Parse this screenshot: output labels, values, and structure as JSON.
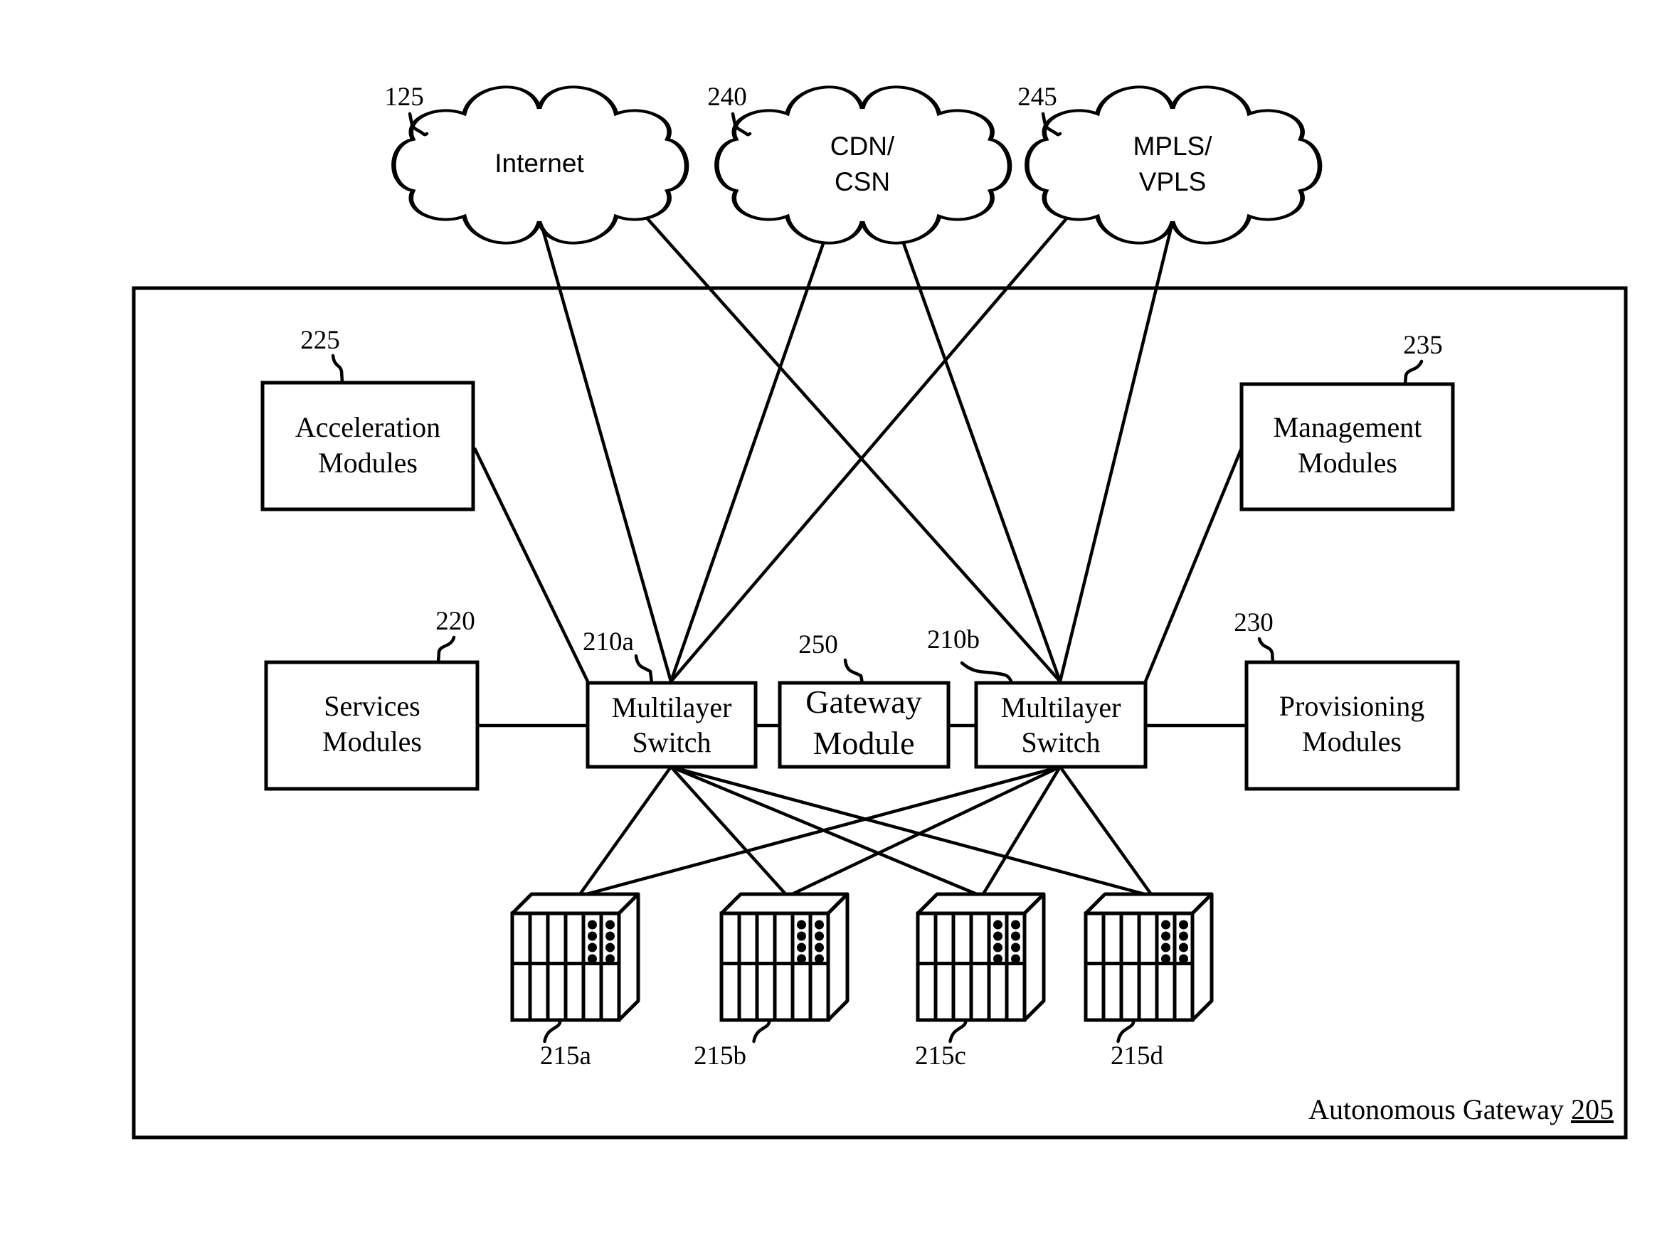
{
  "figure": {
    "container": {
      "label": "Autonomous Gateway",
      "ref": "205"
    },
    "clouds": [
      {
        "id": "internet",
        "ref": "125",
        "lines": [
          "Internet"
        ]
      },
      {
        "id": "cdn",
        "ref": "240",
        "lines": [
          "CDN/",
          "CSN"
        ]
      },
      {
        "id": "mpls",
        "ref": "245",
        "lines": [
          "MPLS/",
          "VPLS"
        ]
      }
    ],
    "modules": [
      {
        "id": "acceleration",
        "ref": "225",
        "lines": [
          "Acceleration",
          "Modules"
        ]
      },
      {
        "id": "management",
        "ref": "235",
        "lines": [
          "Management",
          "Modules"
        ]
      },
      {
        "id": "services",
        "ref": "220",
        "lines": [
          "Services",
          "Modules"
        ]
      },
      {
        "id": "provisioning",
        "ref": "230",
        "lines": [
          "Provisioning",
          "Modules"
        ]
      },
      {
        "id": "switch-a",
        "ref": "210a",
        "lines": [
          "Multilayer",
          "Switch"
        ]
      },
      {
        "id": "gateway",
        "ref": "250",
        "lines": [
          "Gateway",
          "Module"
        ]
      },
      {
        "id": "switch-b",
        "ref": "210b",
        "lines": [
          "Multilayer",
          "Switch"
        ]
      }
    ],
    "servers": [
      {
        "id": "server-a",
        "ref": "215a"
      },
      {
        "id": "server-b",
        "ref": "215b"
      },
      {
        "id": "server-c",
        "ref": "215c"
      },
      {
        "id": "server-d",
        "ref": "215d"
      }
    ],
    "icons": {
      "cloud": "cloud-icon",
      "server": "server-rack-icon"
    }
  }
}
